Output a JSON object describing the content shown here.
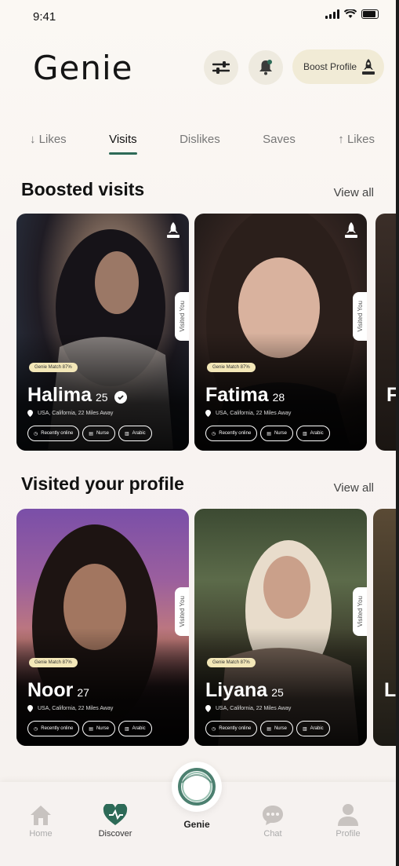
{
  "status": {
    "time": "9:41"
  },
  "header": {
    "logo": "Genie",
    "boost_label": "Boost Profile"
  },
  "tabs": [
    {
      "label": "↓ Likes",
      "active": false
    },
    {
      "label": "Visits",
      "active": true
    },
    {
      "label": "Dislikes",
      "active": false
    },
    {
      "label": "Saves",
      "active": false
    },
    {
      "label": "↑ Likes",
      "active": false
    }
  ],
  "boosted": {
    "title": "Boosted visits",
    "view_all": "View all",
    "cards": [
      {
        "name": "Halima",
        "age": "25",
        "badge": "Genie Match 87%",
        "location": "USA, California, 22 Miles Away",
        "visited": "Visited You",
        "chips": [
          "Recently online",
          "Nurse",
          "Arabic"
        ]
      },
      {
        "name": "Fatima",
        "age": "28",
        "badge": "Genie Match 87%",
        "location": "USA, California, 22 Miles Away",
        "visited": "Visited You",
        "chips": [
          "Recently online",
          "Nurse",
          "Arabic"
        ]
      },
      {
        "name": "F"
      }
    ]
  },
  "visited_profile": {
    "title": "Visited your profile",
    "view_all": "View all",
    "cards": [
      {
        "name": "Noor",
        "age": "27",
        "badge": "Genie Match 87%",
        "location": "USA, California, 22 Miles Away",
        "visited": "Visited You",
        "chips": [
          "Recently online",
          "Nurse",
          "Arabic"
        ]
      },
      {
        "name": "Liyana",
        "age": "25",
        "badge": "Genie Match 87%",
        "location": "USA, California, 22 Miles Away",
        "visited": "Visited You",
        "chips": [
          "Recently online",
          "Nurse",
          "Arabic"
        ]
      },
      {
        "name": "L"
      }
    ]
  },
  "nav": {
    "home": "Home",
    "discover": "Discover",
    "genie": "Genie",
    "chat": "Chat",
    "profile": "Profile"
  },
  "colors": {
    "accent": "#2d6a57",
    "badge": "#f3e7b8"
  }
}
